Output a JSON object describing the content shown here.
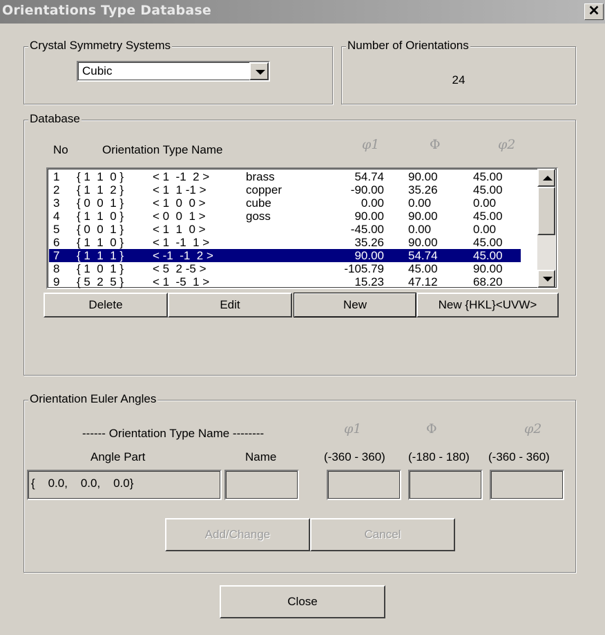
{
  "window": {
    "title": "Orientations Type Database",
    "close_glyph": "✕"
  },
  "symmetry": {
    "legend": "Crystal Symmetry Systems",
    "selected": "Cubic"
  },
  "count": {
    "legend": "Number of Orientations",
    "value": "24"
  },
  "database": {
    "legend": "Database",
    "headers": {
      "no": "No",
      "name": "Orientation Type Name",
      "phi1": "φ1",
      "Phi": "Φ",
      "phi2": "φ2"
    },
    "selected_index": 6,
    "rows": [
      {
        "no": "1",
        "hkl": "{ 1  1  0 }",
        "uvw": "< 1  -1  2 >",
        "label": "brass",
        "phi1": "54.74",
        "Phi": "90.00",
        "phi2": "45.00"
      },
      {
        "no": "2",
        "hkl": "{ 1  1  2 }",
        "uvw": "< 1  1 -1 >",
        "label": "copper",
        "phi1": "-90.00",
        "Phi": "35.26",
        "phi2": "45.00"
      },
      {
        "no": "3",
        "hkl": "{ 0  0  1 }",
        "uvw": "< 1  0  0 >",
        "label": "cube",
        "phi1": "0.00",
        "Phi": "0.00",
        "phi2": "0.00"
      },
      {
        "no": "4",
        "hkl": "{ 1  1  0 }",
        "uvw": "< 0  0  1 >",
        "label": "goss",
        "phi1": "90.00",
        "Phi": "90.00",
        "phi2": "45.00"
      },
      {
        "no": "5",
        "hkl": "{ 0  0  1 }",
        "uvw": "< 1  1  0 >",
        "label": "",
        "phi1": "-45.00",
        "Phi": "0.00",
        "phi2": "0.00"
      },
      {
        "no": "6",
        "hkl": "{ 1  1  0 }",
        "uvw": "< 1  -1  1 >",
        "label": "",
        "phi1": "35.26",
        "Phi": "90.00",
        "phi2": "45.00"
      },
      {
        "no": "7",
        "hkl": "{ 1  1  1 }",
        "uvw": "< -1  -1  2 >",
        "label": "",
        "phi1": "90.00",
        "Phi": "54.74",
        "phi2": "45.00"
      },
      {
        "no": "8",
        "hkl": "{ 1  0  1 }",
        "uvw": "< 5  2 -5 >",
        "label": "",
        "phi1": "-105.79",
        "Phi": "45.00",
        "phi2": "90.00"
      },
      {
        "no": "9",
        "hkl": "{ 5  2  5 }",
        "uvw": "< 1  -5  1 >",
        "label": "",
        "phi1": "15.23",
        "Phi": "47.12",
        "phi2": "68.20"
      }
    ],
    "buttons": {
      "delete": "Delete",
      "edit": "Edit",
      "new": "New",
      "new_hkl": "New {HKL}<UVW>"
    }
  },
  "euler": {
    "legend": "Orientation Euler Angles",
    "type_name_header": "------ Orientation Type Name --------",
    "angle_part_label": "Angle Part",
    "name_label": "Name",
    "phi1_label": "φ1",
    "Phi_label": "Φ",
    "phi2_label": "φ2",
    "phi1_range": "(-360 - 360)",
    "Phi_range": "(-180 - 180)",
    "phi2_range": "(-360 - 360)",
    "angle_part_value": "{    0.0,    0.0,    0.0}",
    "name_value": "",
    "phi1_value": "",
    "Phi_value": "",
    "phi2_value": "",
    "add_change": "Add/Change",
    "cancel": "Cancel"
  },
  "footer": {
    "close": "Close"
  },
  "colors": {
    "selection": "#000080",
    "face": "#d4d0c8",
    "title_gradient_start": "#7f7f7f"
  },
  "icons": {
    "dropdown": "chevron-down-icon",
    "scroll_up": "arrow-up-icon",
    "scroll_down": "arrow-down-icon"
  }
}
